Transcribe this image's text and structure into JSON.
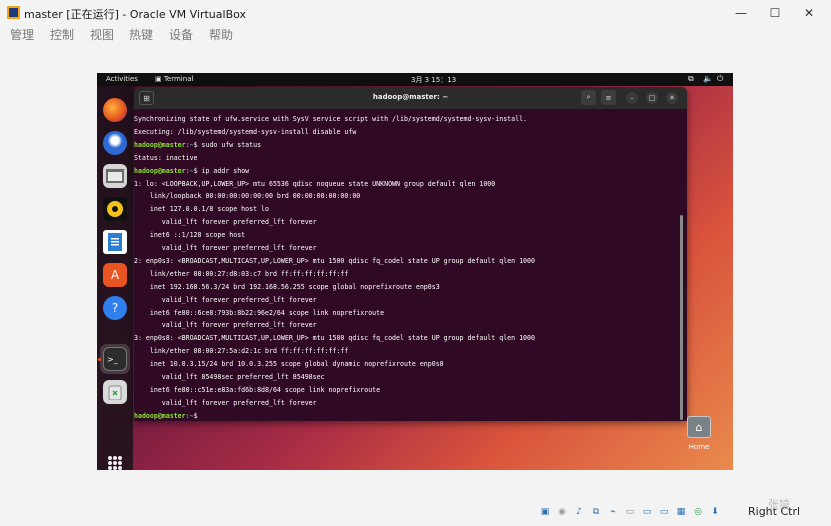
{
  "window": {
    "title": "master [正在运行] - Oracle VM VirtualBox",
    "controls": {
      "minimize": "—",
      "maximize": "☐",
      "close": "✕"
    }
  },
  "menu": [
    "管理",
    "控制",
    "视图",
    "热键",
    "设备",
    "帮助"
  ],
  "guest_topbar": {
    "activities": "Activities",
    "app": "Terminal",
    "clock": "3月 3 15：13",
    "tray": {
      "network": "⧉",
      "sound": "🔈",
      "power": "⏻"
    }
  },
  "dock": {
    "items": [
      "firefox",
      "thunderbird",
      "files",
      "rhythmbox",
      "writer",
      "app-center",
      "help",
      "terminal",
      "trash"
    ]
  },
  "terminal": {
    "title": "hadoop@master: ~",
    "lines": [
      {
        "type": "out",
        "text": "Synchronizing state of ufw.service with SysV service script with /lib/systemd/systemd-sysv-install."
      },
      {
        "type": "out",
        "text": "Executing: /lib/systemd/systemd-sysv-install disable ufw"
      },
      {
        "type": "cmd",
        "user": "hadoop@master",
        "path": ":~",
        "text": "$ sudo ufw status"
      },
      {
        "type": "out",
        "text": "Status: inactive"
      },
      {
        "type": "cmd",
        "user": "hadoop@master",
        "path": ":~",
        "text": "$ ip addr show"
      },
      {
        "type": "out",
        "text": "1: lo: <LOOPBACK,UP,LOWER_UP> mtu 65536 qdisc noqueue state UNKNOWN group default qlen 1000"
      },
      {
        "type": "out",
        "text": "    link/loopback 00:00:00:00:00:00 brd 00:00:00:00:00:00"
      },
      {
        "type": "out",
        "text": "    inet 127.0.0.1/8 scope host lo"
      },
      {
        "type": "out",
        "text": "       valid_lft forever preferred_lft forever"
      },
      {
        "type": "out",
        "text": "    inet6 ::1/128 scope host"
      },
      {
        "type": "out",
        "text": "       valid_lft forever preferred_lft forever"
      },
      {
        "type": "out",
        "text": "2: enp0s3: <BROADCAST,MULTICAST,UP,LOWER_UP> mtu 1500 qdisc fq_codel state UP group default qlen 1000"
      },
      {
        "type": "out",
        "text": "    link/ether 08:00:27:d8:03:c7 brd ff:ff:ff:ff:ff:ff"
      },
      {
        "type": "out",
        "text": "    inet 192.168.56.3/24 brd 192.168.56.255 scope global noprefixroute enp0s3"
      },
      {
        "type": "out",
        "text": "       valid_lft forever preferred_lft forever"
      },
      {
        "type": "out",
        "text": "    inet6 fe80::6ce8:793b:8b22:96e2/64 scope link noprefixroute"
      },
      {
        "type": "out",
        "text": "       valid_lft forever preferred_lft forever"
      },
      {
        "type": "out",
        "text": "3: enp0s8: <BROADCAST,MULTICAST,UP,LOWER_UP> mtu 1500 qdisc fq_codel state UP group default qlen 1000"
      },
      {
        "type": "out",
        "text": "    link/ether 08:00:27:5a:d2:1c brd ff:ff:ff:ff:ff:ff"
      },
      {
        "type": "out",
        "text": "    inet 10.0.3.15/24 brd 10.0.3.255 scope global dynamic noprefixroute enp0s8"
      },
      {
        "type": "out",
        "text": "       valid_lft 85498sec preferred_lft 85498sec"
      },
      {
        "type": "out",
        "text": "    inet6 fe80::c51e:e83a:fd6b:8d8/64 scope link noprefixroute"
      },
      {
        "type": "out",
        "text": "       valid_lft forever preferred_lft forever"
      },
      {
        "type": "cmd",
        "user": "hadoop@master",
        "path": ":~",
        "text": "$ "
      }
    ]
  },
  "desktop": {
    "home_label": "Home"
  },
  "host_status": {
    "key_label": "Right Ctrl"
  },
  "watermark": "张猿"
}
